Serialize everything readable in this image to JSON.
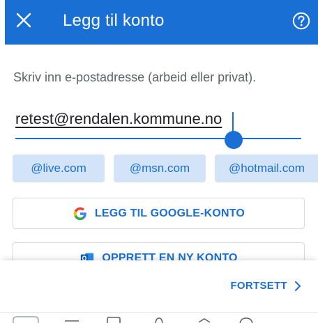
{
  "appbar": {
    "title": "Legg til konto",
    "close_icon": "close-icon",
    "help_icon": "help-icon",
    "background": "#1a6fd4"
  },
  "form": {
    "prompt": "Skriv inn e-postadresse (arbeid eller privat).",
    "email_value": "retest@rendalen.kommune.no"
  },
  "suggestions": [
    "@live.com",
    "@msn.com",
    "@hotmail.com"
  ],
  "buttons": {
    "google_label": "LEGG TIL GOOGLE-KONTO",
    "google_icon": "google-icon",
    "create_label": "OPPRETT EN NY KONTO",
    "create_icon": "outlook-icon"
  },
  "footer": {
    "continue_label": "FORTSETT",
    "continue_icon": "chevron-right-icon"
  },
  "colors": {
    "accent": "#1a6fd4",
    "chip_bg": "#d3e3f8",
    "muted_text": "#5f6368"
  }
}
